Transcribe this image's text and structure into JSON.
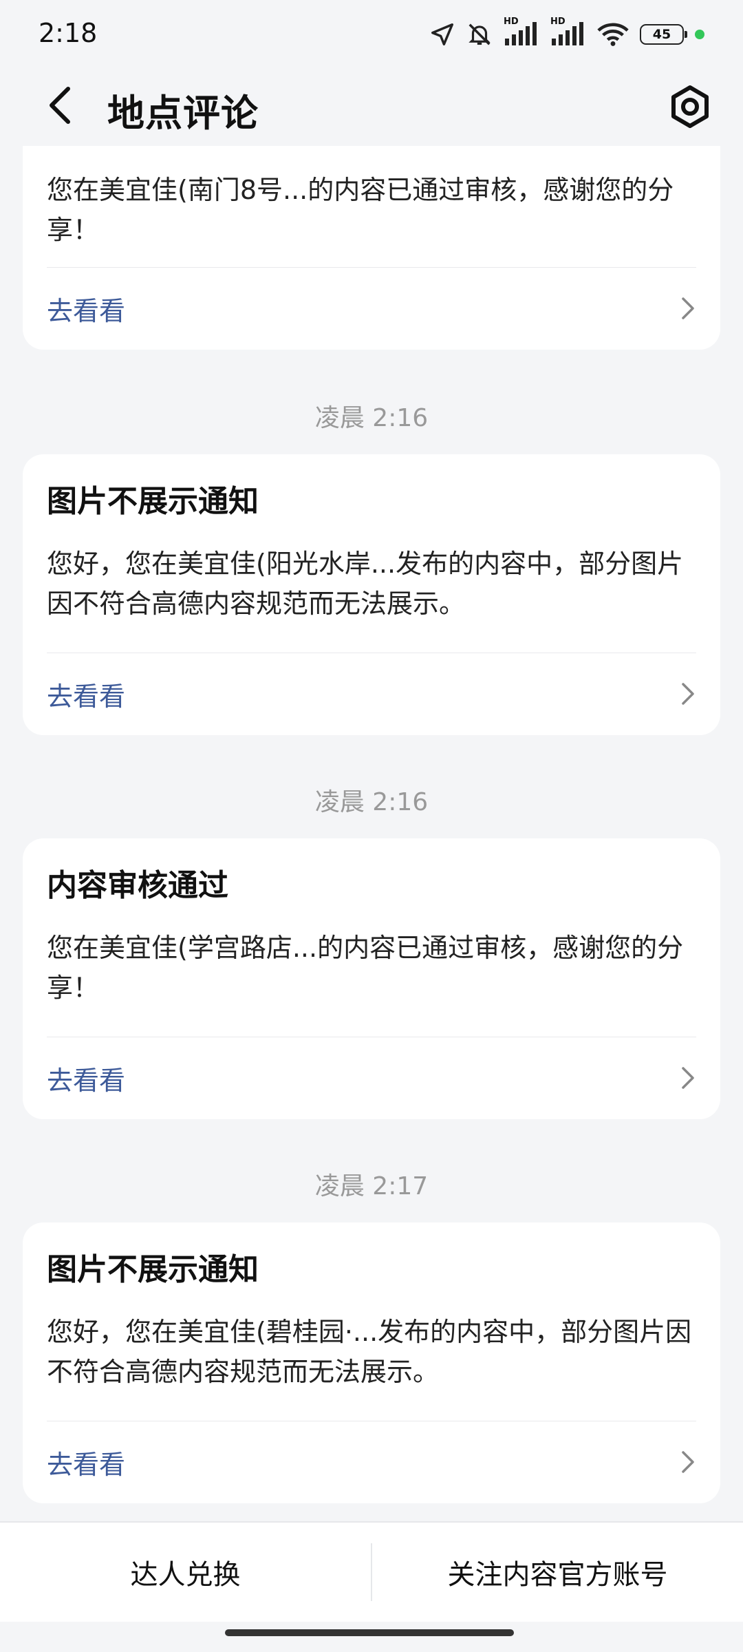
{
  "status_bar": {
    "time": "2:18",
    "battery": "45",
    "hd1": "HD",
    "hd2": "HD",
    "icons": [
      "location-arrow-icon",
      "bell-muted-icon",
      "signal-icon",
      "wifi-icon",
      "battery-icon"
    ],
    "dot_color": "#33c759"
  },
  "header": {
    "title": "地点评论"
  },
  "cards": [
    {
      "title": "",
      "body": "您在美宜佳(南门8号...的内容已通过审核，感谢您的分享！",
      "link": "去看看"
    },
    {
      "timestamp": "凌晨 2:16",
      "title": "图片不展示通知",
      "body": "您好，您在美宜佳(阳光水岸...发布的内容中，部分图片因不符合高德内容规范而无法展示。",
      "link": "去看看"
    },
    {
      "timestamp": "凌晨 2:16",
      "title": "内容审核通过",
      "body": "您在美宜佳(学宫路店...的内容已通过审核，感谢您的分享！",
      "link": "去看看"
    },
    {
      "timestamp": "凌晨 2:17",
      "title": "图片不展示通知",
      "body": "您好，您在美宜佳(碧桂园·...发布的内容中，部分图片因不符合高德内容规范而无法展示。",
      "link": "去看看"
    }
  ],
  "bottom_bar": {
    "left": "达人兑换",
    "right": "关注内容官方账号"
  },
  "colors": {
    "link": "#3d5a99",
    "background": "#f4f5f7",
    "card": "#ffffff"
  }
}
